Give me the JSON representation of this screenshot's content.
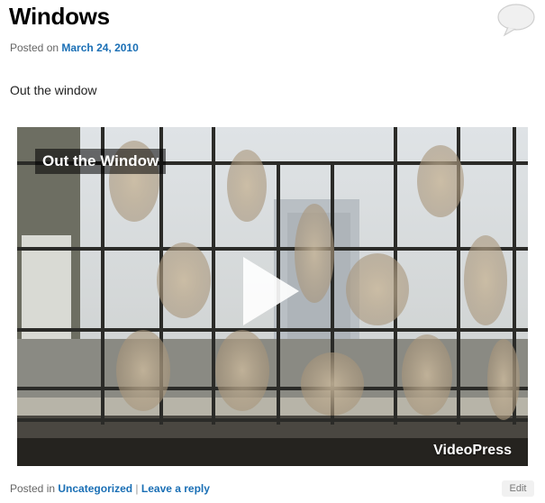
{
  "post": {
    "title": "Windows",
    "posted_on_label": "Posted on",
    "date": "March 24, 2010",
    "body": "Out the window"
  },
  "video": {
    "title": "Out the Window",
    "brand": "VideoPress",
    "play_icon": "play-icon"
  },
  "footer": {
    "posted_in_label": "Posted in",
    "category": "Uncategorized",
    "separator": "|",
    "reply_link": "Leave a reply",
    "edit_label": "Edit"
  },
  "icons": {
    "comments": "comment-bubble-icon"
  }
}
